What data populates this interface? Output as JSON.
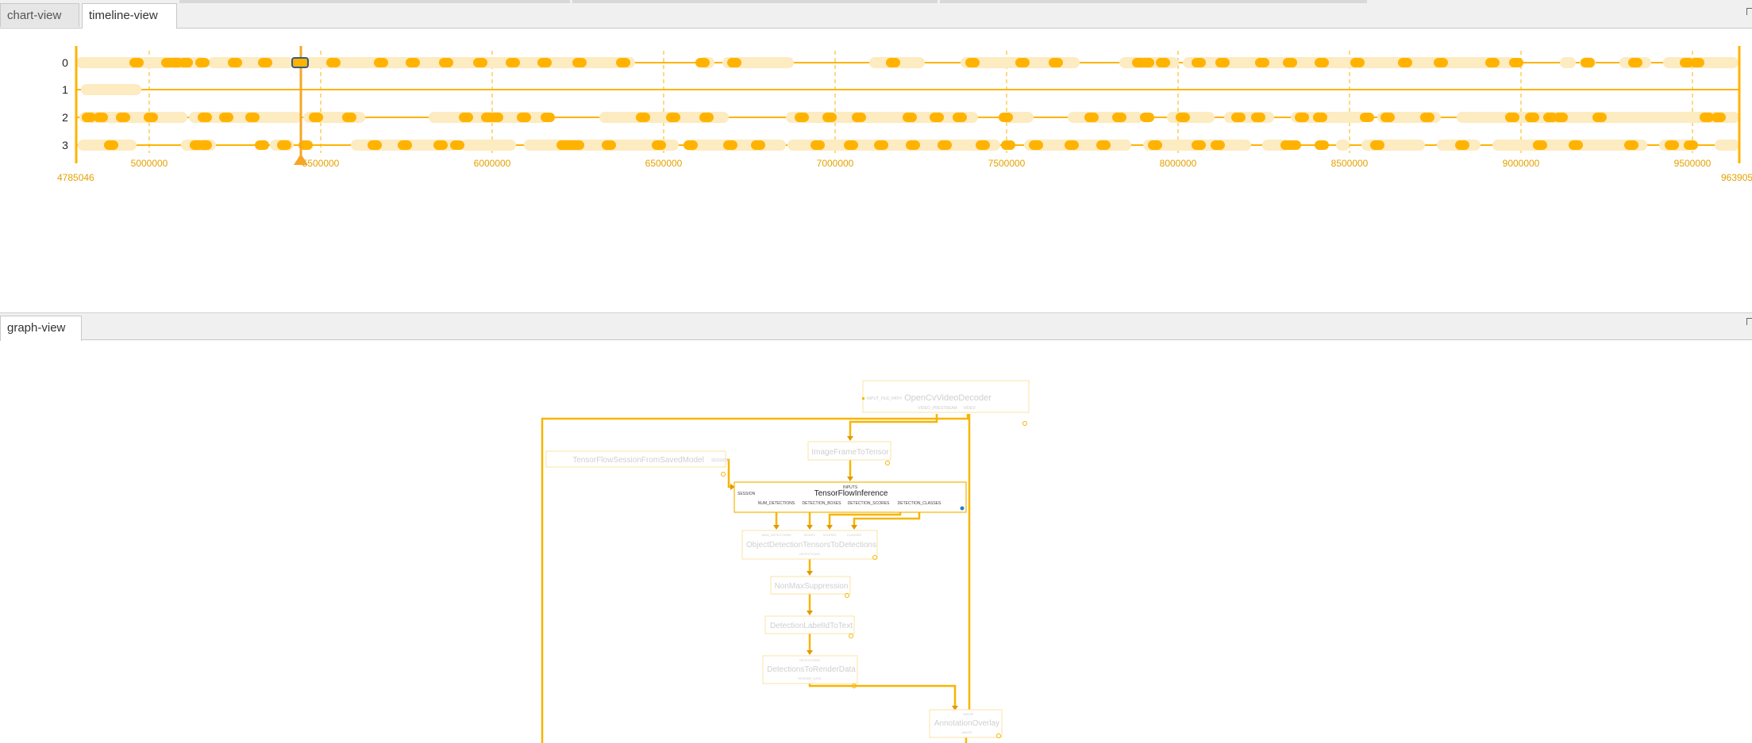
{
  "tabs_top": [
    {
      "label": "chart-view",
      "active": false
    },
    {
      "label": "timeline-view",
      "active": true
    }
  ],
  "tabs_bottom": [
    {
      "label": "graph-view",
      "active": true
    }
  ],
  "timeline": {
    "rows": [
      "0",
      "1",
      "2",
      "3"
    ],
    "range_start": "4785046",
    "range_end": "963905",
    "ticks": [
      "5000000",
      "5500000",
      "6000000",
      "6500000",
      "7000000",
      "7500000",
      "8000000",
      "8500000",
      "9000000",
      "9500000"
    ],
    "accent": "#ffb300",
    "light": "#fdebc1",
    "cursor_color": "#f6a623"
  },
  "graph": {
    "nodes": {
      "decoder": {
        "title": "OpenCvVideoDecoder",
        "in": "INPUT_FILE_PATH",
        "out1": "VIDEO_PRESTREAM",
        "out2": "VIDEO"
      },
      "session": {
        "title": "TensorFlowSessionFromSavedModel",
        "out": "SESSION"
      },
      "tensor": {
        "title": "ImageFrameToTensor"
      },
      "inference": {
        "title": "TensorFlowInference",
        "inputs": "INPUTS",
        "session": "SESSION",
        "out1": "NUM_DETECTIONS",
        "out2": "DETECTION_BOXES",
        "out3": "DETECTION_SCORES",
        "out4": "DETECTION_CLASSES"
      },
      "od": {
        "title": "ObjectDetectionTensorsToDetections",
        "in1": "NUM_DETECTIONS",
        "in2": "BOXES",
        "in3": "SCORES",
        "in4": "CLASSES",
        "out": "DETECTIONS"
      },
      "nms": {
        "title": "NonMaxSuppression"
      },
      "label": {
        "title": "DetectionLabelIdToText"
      },
      "render": {
        "title": "DetectionsToRenderData",
        "in": "DETECTIONS",
        "out": "RENDER_DATA"
      },
      "overlay": {
        "title": "AnnotationOverlay",
        "in": "IMAGE",
        "out": "IMAGE"
      }
    }
  }
}
